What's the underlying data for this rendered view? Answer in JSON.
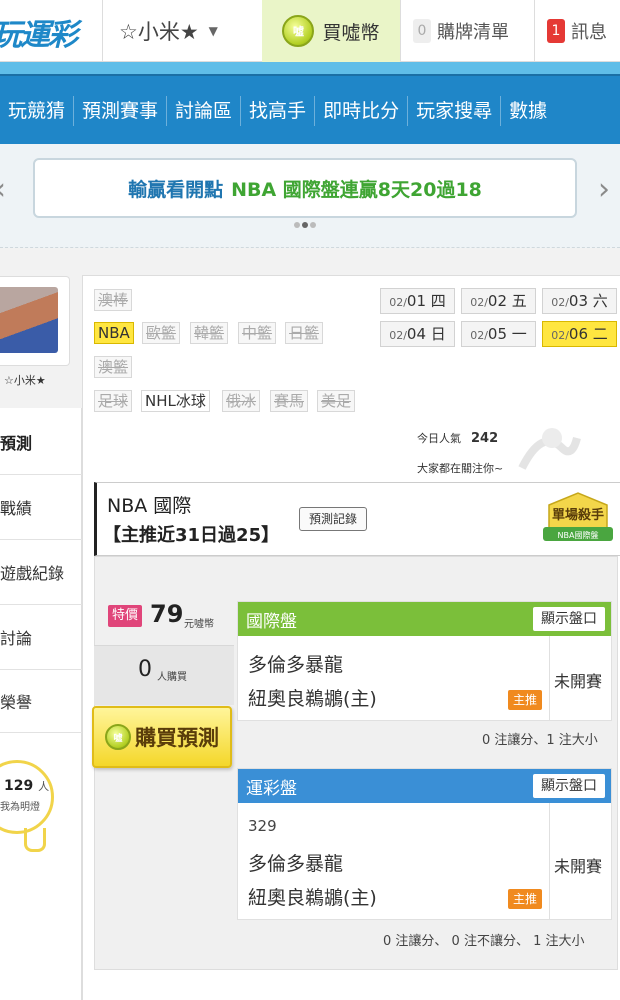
{
  "header": {
    "logo": "玩運彩",
    "user_name": "☆小米★",
    "coin_icon_text": "噓",
    "buy_coin_label": "買噓幣",
    "cart_count": "0",
    "cart_label": "購牌清單",
    "message_count": "1",
    "message_label": "訊息"
  },
  "nav": {
    "items": [
      "玩競猜",
      "預測賽事",
      "討論區",
      "找高手",
      "即時比分",
      "玩家搜尋",
      "數據"
    ]
  },
  "banner": {
    "text_blue": "輸贏看開點",
    "text_green": "NBA 國際盤連贏8天20過18",
    "left_arrow": "‹",
    "right_arrow": "›"
  },
  "sidebar": {
    "user_name": "☆小米★",
    "section_title": "預測",
    "items": [
      "戰績",
      "遊戲紀錄",
      "討論",
      "榮譽"
    ],
    "light_count": "129",
    "light_unit": "人",
    "light_sub": "我為明燈"
  },
  "categories": {
    "row1": [
      "澳棒"
    ],
    "row2": [
      "NBA",
      "歐籃",
      "韓籃",
      "中籃",
      "日籃"
    ],
    "row3": [
      "澳籃"
    ],
    "row4": [
      "足球",
      "NHL冰球",
      "俄冰",
      "賽馬",
      "美足"
    ]
  },
  "dates": [
    {
      "md": "02/",
      "d": "01",
      "w": "四"
    },
    {
      "md": "02/",
      "d": "02",
      "w": "五"
    },
    {
      "md": "02/",
      "d": "03",
      "w": "六"
    },
    {
      "md": "02/",
      "d": "04",
      "w": "日"
    },
    {
      "md": "02/",
      "d": "05",
      "w": "一"
    },
    {
      "md": "02/",
      "d": "06",
      "w": "二"
    }
  ],
  "popularity": {
    "label": "今日人氣",
    "value": "242",
    "sub": "大家都在關注你~"
  },
  "prediction": {
    "league": "NBA 國際",
    "record": "【主推近31日過25】",
    "record_button": "預測記錄",
    "killer_title": "單場殺手",
    "killer_sub": "NBA國際盤"
  },
  "purchase": {
    "special_label": "特價",
    "price": "79",
    "price_unit": "元噓幣",
    "buyers": "0",
    "buyers_unit": "人購買",
    "buy_button": "購買預測"
  },
  "markets": [
    {
      "name": "國際盤",
      "show_button": "顯示盤口",
      "game_id": "",
      "away_team": "多倫多暴龍",
      "home_team": "紐奧良鵜鶘(主)",
      "tag": "主推",
      "status": "未開賽",
      "summary": "0 注讓分、1 注大小"
    },
    {
      "name": "運彩盤",
      "show_button": "顯示盤口",
      "game_id": "329",
      "away_team": "多倫多暴龍",
      "home_team": "紐奧良鵜鶘(主)",
      "tag": "主推",
      "status": "未開賽",
      "summary": "0 注讓分、 0 注不讓分、 1 注大小"
    }
  ]
}
